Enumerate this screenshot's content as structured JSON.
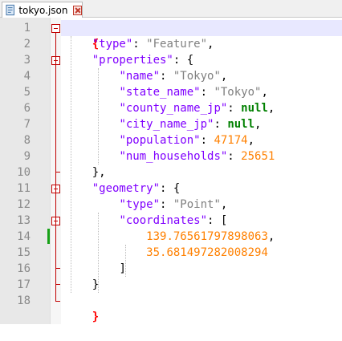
{
  "tab": {
    "filename": "tokyo.json",
    "icon": "file-icon",
    "close_icon": "close-icon"
  },
  "line_numbers": [
    "1",
    "2",
    "3",
    "4",
    "5",
    "6",
    "7",
    "8",
    "9",
    "10",
    "11",
    "12",
    "13",
    "14",
    "15",
    "16",
    "17",
    "18"
  ],
  "code": {
    "l1": {
      "brace": "{"
    },
    "l2": {
      "indent": "    ",
      "key": "\"type\"",
      "colon": ": ",
      "value": "\"Feature\"",
      "comma": ","
    },
    "l3": {
      "indent": "    ",
      "key": "\"properties\"",
      "colon": ": ",
      "brace": "{"
    },
    "l4": {
      "indent": "        ",
      "key": "\"name\"",
      "colon": ": ",
      "value": "\"Tokyo\"",
      "comma": ","
    },
    "l5": {
      "indent": "        ",
      "key": "\"state_name\"",
      "colon": ": ",
      "value": "\"Tokyo\"",
      "comma": ","
    },
    "l6": {
      "indent": "        ",
      "key": "\"county_name_jp\"",
      "colon": ": ",
      "value": "null",
      "comma": ","
    },
    "l7": {
      "indent": "        ",
      "key": "\"city_name_jp\"",
      "colon": ": ",
      "value": "null",
      "comma": ","
    },
    "l8": {
      "indent": "        ",
      "key": "\"population\"",
      "colon": ": ",
      "value": "47174",
      "comma": ","
    },
    "l9": {
      "indent": "        ",
      "key": "\"num_households\"",
      "colon": ": ",
      "value": "25651"
    },
    "l10": {
      "indent": "    ",
      "text": "},"
    },
    "l11": {
      "indent": "    ",
      "key": "\"geometry\"",
      "colon": ": ",
      "brace": "{"
    },
    "l12": {
      "indent": "        ",
      "key": "\"type\"",
      "colon": ": ",
      "value": "\"Point\"",
      "comma": ","
    },
    "l13": {
      "indent": "        ",
      "key": "\"coordinates\"",
      "colon": ": ",
      "bracket": "["
    },
    "l14": {
      "indent": "            ",
      "value": "139.76561797898063",
      "comma": ","
    },
    "l15": {
      "indent": "            ",
      "value": "35.681497282008294"
    },
    "l16": {
      "indent": "        ",
      "text": "]"
    },
    "l17": {
      "indent": "    ",
      "text": "}"
    },
    "l18": {
      "brace": "}"
    }
  },
  "colors": {
    "key": "#8000ff",
    "string": "#808080",
    "number": "#ff8000",
    "keyword": "#008000",
    "brace_match": "#ff0000",
    "fold_marker": "#c00000",
    "change_marker": "#17a117",
    "current_line": "#e8e8ff"
  }
}
